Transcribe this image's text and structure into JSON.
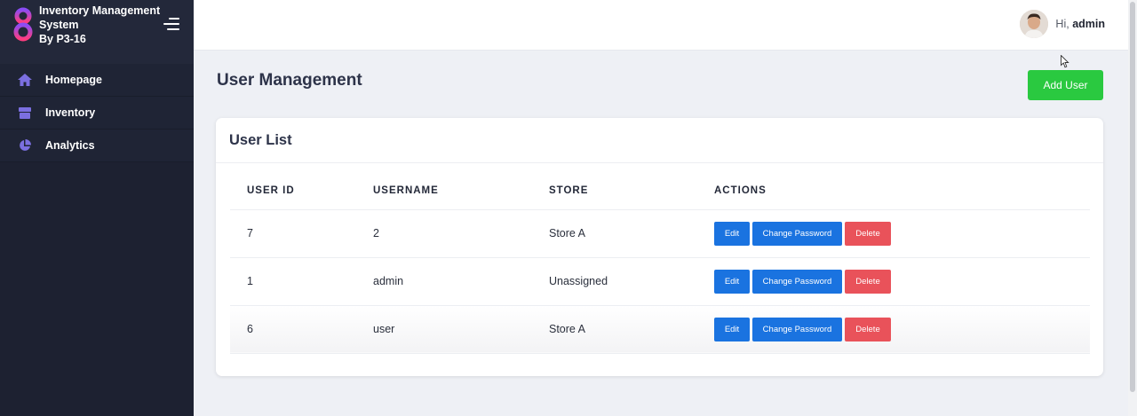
{
  "brand": {
    "title_line1": "Inventory Management",
    "title_line2": "System",
    "title_line3": "By P3-16",
    "logo_icon": "brand-logo-icon",
    "toggle_icon": "menu-toggle-icon"
  },
  "sidebar": {
    "items": [
      {
        "label": "Homepage",
        "icon": "home-icon"
      },
      {
        "label": "Inventory",
        "icon": "box-icon"
      },
      {
        "label": "Analytics",
        "icon": "pie-chart-icon"
      }
    ]
  },
  "topbar": {
    "greeting": "Hi,",
    "username": "admin"
  },
  "page": {
    "title": "User Management",
    "add_button": "Add User"
  },
  "card": {
    "title": "User List",
    "columns": [
      "USER ID",
      "USERNAME",
      "STORE",
      "ACTIONS"
    ],
    "rows": [
      {
        "id": "7",
        "username": "2",
        "store": "Store A"
      },
      {
        "id": "1",
        "username": "admin",
        "store": "Unassigned"
      },
      {
        "id": "6",
        "username": "user",
        "store": "Store A"
      }
    ],
    "actions": {
      "edit": "Edit",
      "change_password": "Change Password",
      "delete": "Delete"
    }
  },
  "colors": {
    "sidebar_bg": "#1d2131",
    "accent_green": "#2ac940",
    "accent_blue": "#1a73e0",
    "accent_red": "#e9525a",
    "nav_icon": "#7b6fe0"
  }
}
